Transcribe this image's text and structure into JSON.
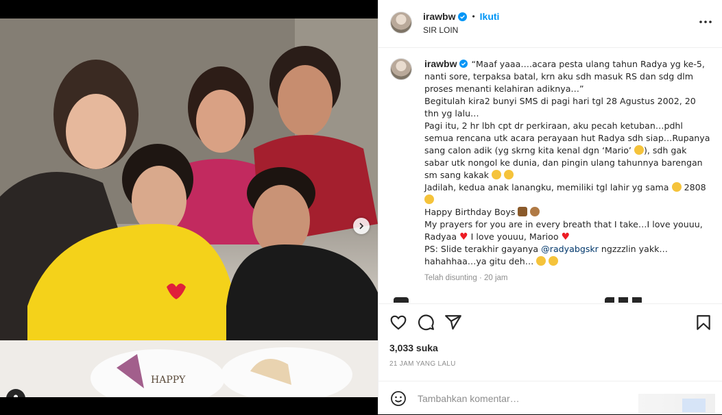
{
  "post": {
    "username": "irawbw",
    "verified": true,
    "follow_label": "Ikuti",
    "location": "SIR LOIN"
  },
  "caption": {
    "lines": [
      "“Maaf yaaa….acara pesta ulang tahun Radya yg ke-5, nanti sore, terpaksa batal, krn aku sdh masuk RS dan sdg dlm proses menanti kelahiran adiknya…”",
      "Begitulah kira2 bunyi SMS di pagi hari tgl 28 Agustus 2002, 20 thn yg lalu…",
      "Pagi itu, 2 hr lbh cpt dr perkiraan, aku pecah ketuban…pdhl semua rencana utk acara perayaan hut Radya sdh siap…Rupanya sang calon adik (yg skrng kita kenal dgn ‘Mario’",
      "), sdh gak sabar utk nongol ke dunia, dan pingin ulang tahunnya barengan sm sang kakak",
      "Jadilah, kedua anak lanangku, memiliki tgl lahir yg sama",
      "2808",
      "Happy Birthday Boys",
      "My prayers for you are in every breath that I take…I love youuu, Radyaa",
      "I love youuu, Marioo",
      "PS: Slide terakhir gayanya",
      "@radyabgskr",
      "ngzzzlin yakk… hahahhaa…ya gitu deh…"
    ],
    "edited_label": "Telah disunting",
    "relative_time": "20 jam"
  },
  "icons": {
    "like": "heart-icon",
    "comment": "comment-icon",
    "share": "paper-plane-icon",
    "save": "bookmark-icon",
    "more": "more-horizontal-icon",
    "emoji": "smiley-icon",
    "next": "chevron-right-icon",
    "tag": "user-tag-icon"
  },
  "stats": {
    "likes": "3,033 suka",
    "time_ago": "21 JAM YANG LALU"
  },
  "comment_box": {
    "placeholder": "Tambahkan komentar…"
  },
  "colors": {
    "accent": "#0095f6",
    "mention": "#00376b",
    "heart": "#ed1c24",
    "text": "#262626",
    "secondary": "#8e8e8e"
  }
}
